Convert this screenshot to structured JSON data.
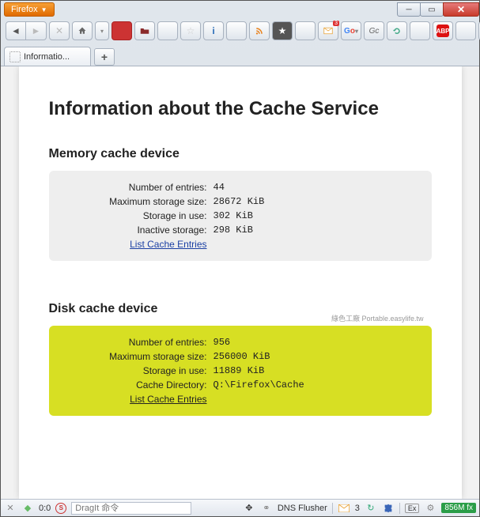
{
  "app": {
    "name": "Firefox"
  },
  "tabs": {
    "active_title": "Informatio..."
  },
  "page": {
    "title": "Information about the Cache Service",
    "memory": {
      "heading": "Memory cache device",
      "labels": {
        "entries": "Number of entries:",
        "max": "Maximum storage size:",
        "inuse": "Storage in use:",
        "inactive": "Inactive storage:"
      },
      "values": {
        "entries": "44",
        "max": "28672 KiB",
        "inuse": "302 KiB",
        "inactive": "298 KiB"
      },
      "link": "List Cache Entries"
    },
    "disk": {
      "heading": "Disk cache device",
      "watermark": "綠色工廠 Portable.easylife.tw",
      "labels": {
        "entries": "Number of entries:",
        "max": "Maximum storage size:",
        "inuse": "Storage in use:",
        "dir": "Cache Directory:"
      },
      "values": {
        "entries": "956",
        "max": "256000 KiB",
        "inuse": "11889 KiB",
        "dir": "Q:\\Firefox\\Cache"
      },
      "link": "List Cache Entries"
    }
  },
  "statusbar": {
    "progress": "0:0",
    "dragit_placeholder": "DragIt 命令",
    "dnsflusher": "DNS Flusher",
    "mail_count": "3",
    "ex_label": "Ex",
    "memory": "856M fx"
  }
}
